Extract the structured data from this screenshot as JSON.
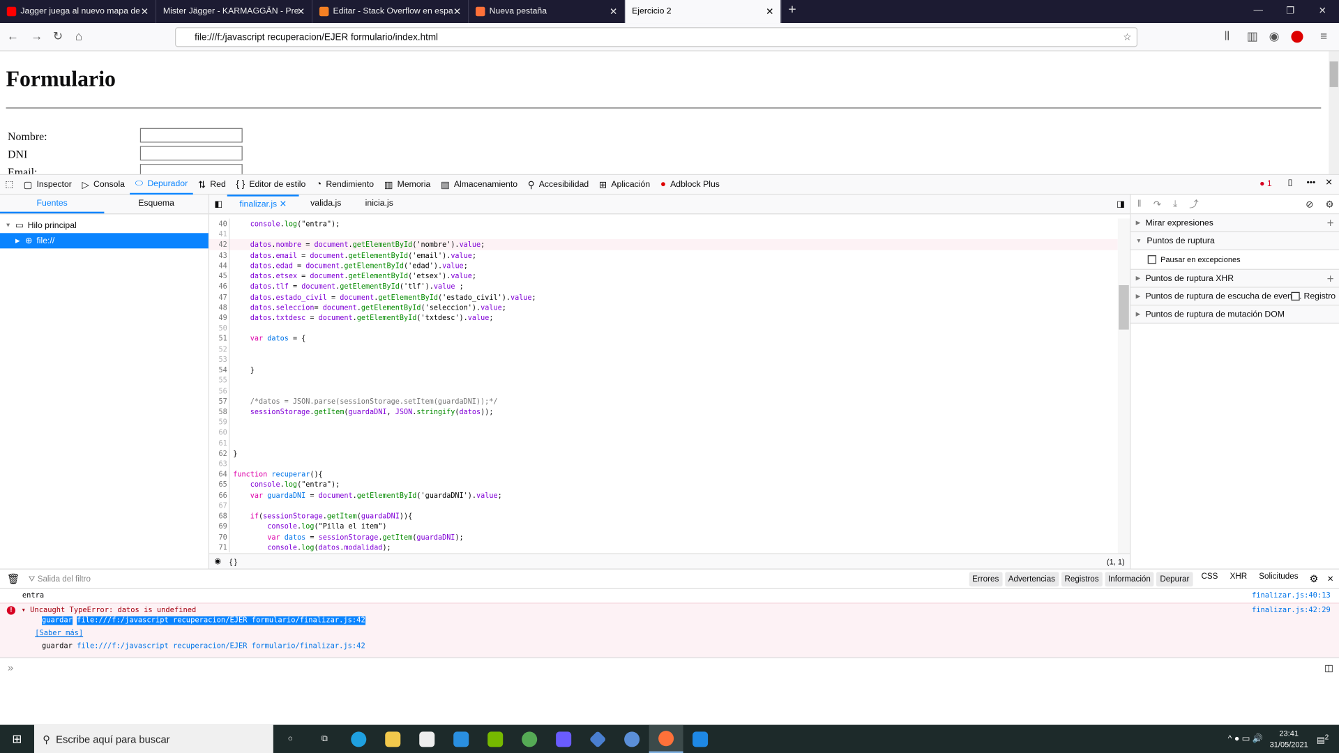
{
  "browser": {
    "tabs": [
      {
        "title": "Jagger juega al nuevo mapa de",
        "icon_color": "#ff0000",
        "active": false
      },
      {
        "title": "Mister Jägger - KARMAGGÄN - Pre",
        "icon_color": "",
        "active": false
      },
      {
        "title": "Editar - Stack Overflow en espa",
        "icon_color": "#f48024",
        "active": false
      },
      {
        "title": "Nueva pestaña",
        "icon_color": "#ff7139",
        "active": false
      },
      {
        "title": "Ejercicio 2",
        "icon_color": "",
        "active": true
      }
    ],
    "url": "file:///f:/javascript recuperacion/EJER formulario/index.html"
  },
  "page": {
    "heading": "Formulario",
    "fields": [
      {
        "label": "Nombre:",
        "value": ""
      },
      {
        "label": "DNI",
        "value": ""
      },
      {
        "label": "Email:",
        "value": ""
      }
    ]
  },
  "devtools": {
    "tools": [
      "Inspector",
      "Consola",
      "Depurador",
      "Red",
      "Editor de estilo",
      "Rendimiento",
      "Memoria",
      "Almacenamiento",
      "Accesibilidad",
      "Aplicación",
      "Adblock Plus"
    ],
    "active_tool": "Depurador",
    "error_count": "1",
    "sources_tabs": [
      "Fuentes",
      "Esquema"
    ],
    "tree": [
      "Hilo principal",
      "file://"
    ],
    "editor_tabs": [
      "finalizar.js",
      "valida.js",
      "inicia.js"
    ],
    "cursor_pos": "(1, 1)",
    "footer_braces": "{ }",
    "code_start": 40,
    "highlight_line": 42,
    "code": [
      "    console.log(\"entra\");",
      "",
      "    datos.nombre = document.getElementById('nombre').value;",
      "    datos.email = document.getElementById('email').value;",
      "    datos.edad = document.getElementById('edad').value;",
      "    datos.etsex = document.getElementById('etsex').value;",
      "    datos.tlf = document.getElementById('tlf').value ;",
      "    datos.estado_civil = document.getElementById('estado_civil').value;",
      "    datos.seleccion= document.getElementById('seleccion').value;",
      "    datos.txtdesc = document.getElementById('txtdesc').value;",
      "",
      "    var datos = {",
      "",
      "",
      "    }",
      "",
      "",
      "    /*datos = JSON.parse(sessionStorage.setItem(guardaDNI));*/",
      "    sessionStorage.getItem(guardaDNI, JSON.stringify(datos));",
      "",
      "",
      "",
      "}",
      "",
      "function recuperar(){",
      "    console.log(\"entra\");",
      "    var guardaDNI = document.getElementById('guardaDNI').value;",
      "",
      "    if(sessionStorage.getItem(guardaDNI)){",
      "        console.log(\"Pilla el item\")",
      "        var datos = sessionStorage.getItem(guardaDNI);",
      "        console.log(datos.modalidad);"
    ],
    "panes": {
      "watch": "Mirar expresiones",
      "breakpoints": "Puntos de ruptura",
      "pause_exceptions": "Pausar en excepciones",
      "xhr": "Puntos de ruptura XHR",
      "events": "Puntos de ruptura de escucha de event...",
      "log": "Registro",
      "dom": "Puntos de ruptura de mutación DOM"
    }
  },
  "console": {
    "filter_placeholder": "Salida del filtro",
    "filters": [
      "Errores",
      "Advertencias",
      "Registros",
      "Información",
      "Depurar"
    ],
    "extra": [
      "CSS",
      "XHR",
      "Solicitudes"
    ],
    "log_text": "entra",
    "log_loc": "finalizar.js:40:13",
    "error_text": "Uncaught TypeError: datos is undefined",
    "error_loc": "finalizar.js:42:29",
    "stack_fn": "guardar",
    "stack_path": "file:///f:/javascript recuperacion/EJER formulario/finalizar.js:42",
    "learn_more": "[Saber más]"
  },
  "taskbar": {
    "search_placeholder": "Escribe aquí para buscar",
    "time": "23:41",
    "date": "31/05/2021",
    "notifications": "2"
  }
}
